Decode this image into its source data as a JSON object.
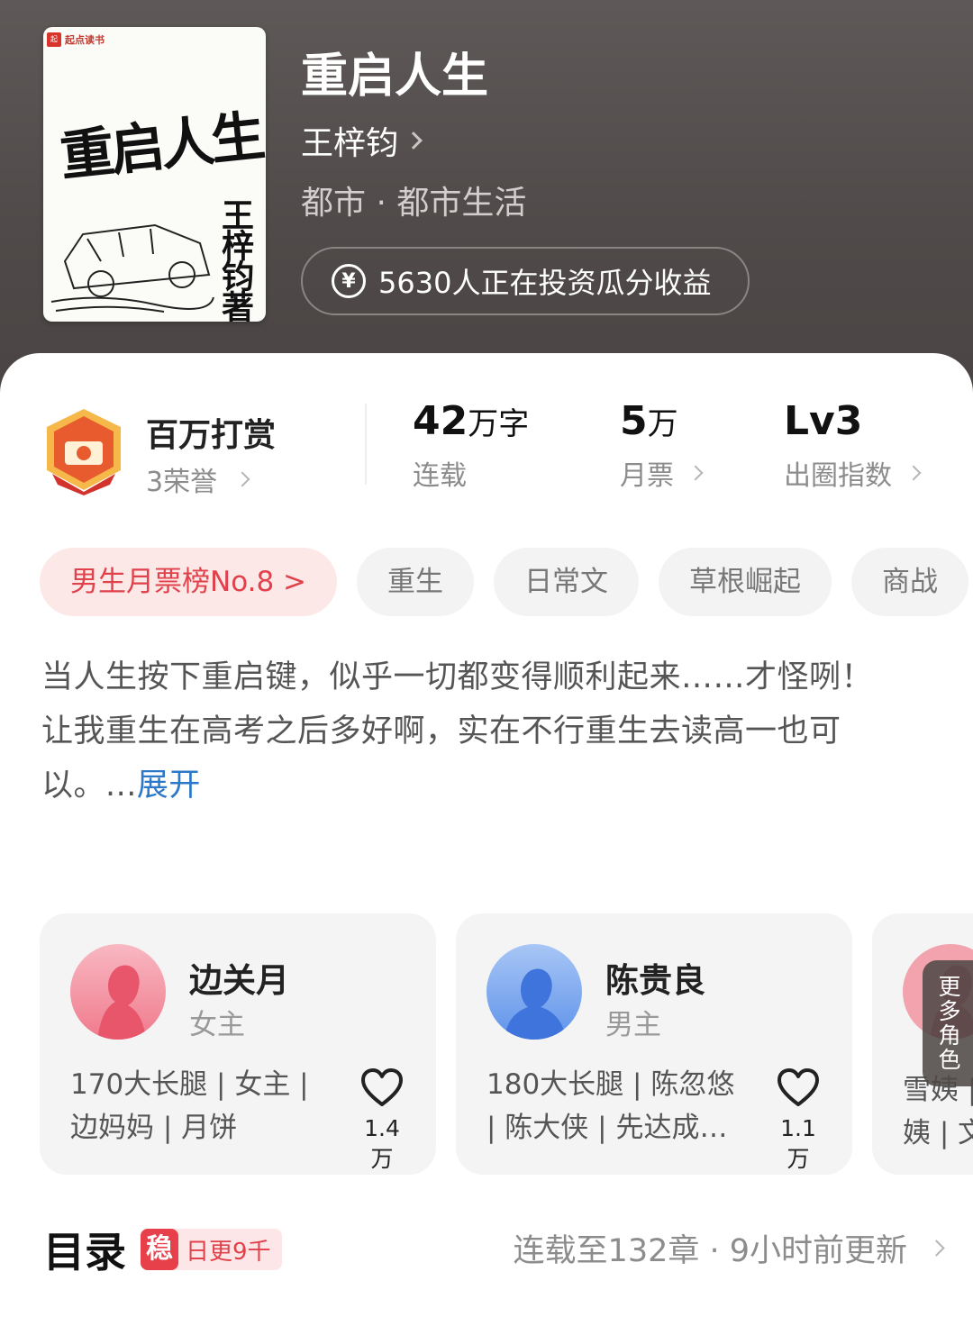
{
  "cover": {
    "publisher_logo": "起点读书",
    "title_art": "重启人生",
    "author_art": "王梓钧著"
  },
  "book": {
    "title": "重启人生",
    "author": "王梓钧",
    "genre": "都市 · 都市生活",
    "invest_text": "5630人正在投资瓜分收益"
  },
  "reward": {
    "title": "百万打赏",
    "honors": "3荣誉"
  },
  "stats": {
    "words_num": "42",
    "words_unit": "万字",
    "words_label": "连载",
    "tickets_num": "5",
    "tickets_unit": "万",
    "tickets_label": "月票",
    "level": "Lv3",
    "level_label": "出圈指数"
  },
  "tags": [
    "男生月票榜No.8 >",
    "重生",
    "日常文",
    "草根崛起",
    "商战"
  ],
  "synopsis": {
    "line1": "当人生按下重启键，似乎一切都变得顺利起来……才怪咧！",
    "line2": "让我重生在高考之后多好啊，实在不行重生去读高一也可以。...",
    "expand": "展开"
  },
  "characters": [
    {
      "name": "边关月",
      "role": "女主",
      "desc": "170大长腿 | 女主 | 边妈妈 | 月饼",
      "likes": "1.4万"
    },
    {
      "name": "陈贵良",
      "role": "男主",
      "desc": "180大长腿 | 陈忽悠 | 陈大侠 | 先达成…",
      "likes": "1.1万"
    },
    {
      "partial_text": "雪姨 |\n姨 | 文"
    }
  ],
  "more_roles": "更多角色",
  "toc": {
    "title": "目录",
    "badge_icon": "稳",
    "badge_text": "日更9千",
    "status": "连载至132章 · 9小时前更新"
  },
  "colors": {
    "accent_red": "#e0414a",
    "link_blue": "#2b78c8",
    "hero_bg": "#55504f"
  }
}
